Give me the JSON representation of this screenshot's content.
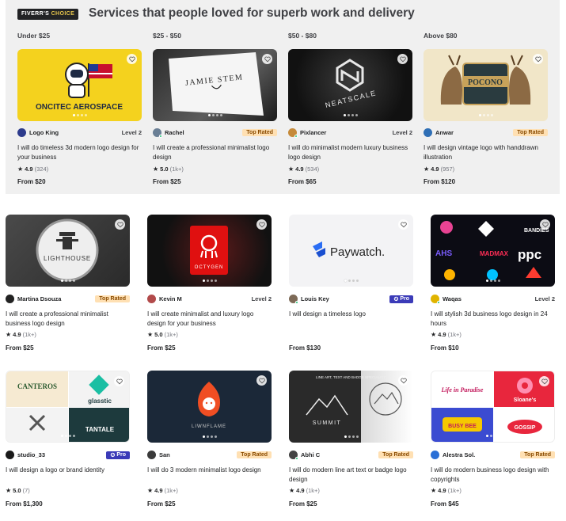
{
  "header": {
    "badge_prefix": "FIVERR'S",
    "badge_suffix": "CHOICE",
    "title": "Services that people loved for superb work and delivery"
  },
  "price_ranges": [
    "Under $25",
    "$25 - $50",
    "$50 - $80",
    "Above $80"
  ],
  "choice_gigs": [
    {
      "seller": "Logo King",
      "level": "Level 2",
      "title": "I will do timeless 3d modern logo design for your business",
      "score": "4.9",
      "count": "(324)",
      "price": "From $20",
      "thumb_text": "ONCITEC AEROSPACE",
      "avatar_color": "#2d3b8c"
    },
    {
      "seller": "Rachel",
      "level": "Top Rated",
      "title": "I will create a professional minimalist logo design",
      "score": "5.0",
      "count": "(1k+)",
      "price": "From $25",
      "thumb_text": "JAMIE STEM",
      "avatar_color": "#6a7f95"
    },
    {
      "seller": "Pixlancer",
      "level": "Level 2",
      "title": "I will do minimalist modern luxury business logo design",
      "score": "4.9",
      "count": "(534)",
      "price": "From $65",
      "thumb_text": "NEATSCALE",
      "avatar_color": "#c58a3a"
    },
    {
      "seller": "Anwar",
      "level": "Top Rated",
      "title": "I will design vintage logo with handdrawn illustration",
      "score": "4.9",
      "count": "(957)",
      "price": "From $120",
      "thumb_text": "POCONO",
      "avatar_color": "#2f6fb5"
    }
  ],
  "gigs": [
    {
      "seller": "Martina Dsouza",
      "level": "Top Rated",
      "title": "I will create a professional minimalist business logo design",
      "score": "4.9",
      "count": "(1k+)",
      "price": "From $25",
      "thumb_text": "LIGHTHOUSE",
      "avatar_color": "#222222"
    },
    {
      "seller": "Kevin M",
      "level": "Level 2",
      "title": "I will create minimalist and luxury logo design for your business",
      "score": "5.0",
      "count": "(1k+)",
      "price": "From $25",
      "thumb_text": "OCTYGEN",
      "avatar_color": "#b24a4a"
    },
    {
      "seller": "Louis Key",
      "level": "Pro",
      "title": "I will design a timeless logo",
      "score": "",
      "count": "",
      "price": "From $130",
      "thumb_text": "Paywatch.",
      "avatar_color": "#7d6a57"
    },
    {
      "seller": "Waqas",
      "level": "Level 2",
      "title": "I will stylish 3d business logo design in 24 hours",
      "score": "4.9",
      "count": "(1k+)",
      "price": "From $10",
      "thumb_text": "ppc",
      "avatar_color": "#e0b400"
    },
    {
      "seller": "studio_33",
      "level": "Pro",
      "title": "I will design a logo or brand identity",
      "score": "5.0",
      "count": "(7)",
      "price": "From $1,300",
      "thumb_text": "CANTEROS",
      "avatar_color": "#1a1a1a"
    },
    {
      "seller": "San",
      "level": "Top Rated",
      "title": "I will do 3 modern minimalist logo design",
      "score": "4.9",
      "count": "(1k+)",
      "price": "From $25",
      "thumb_text": "LIWNFLAME",
      "avatar_color": "#3a3a3a"
    },
    {
      "seller": "Abhi C",
      "level": "Top Rated",
      "title": "I will do modern line art text or badge logo design",
      "score": "4.9",
      "count": "(1k+)",
      "price": "From $25",
      "thumb_text": "SUMMIT",
      "avatar_color": "#444444"
    },
    {
      "seller": "Alestra Sol.",
      "level": "Top Rated",
      "title": "I will do modern business logo design with copyrights",
      "score": "4.9",
      "count": "(1k+)",
      "price": "From $45",
      "thumb_text": "Life in Paradise",
      "avatar_color": "#2a6fd6"
    }
  ],
  "colors": {
    "accent_green": "#1dbf73",
    "top_rated_bg": "#ffe0b3",
    "pro_bg": "#3b3bb8",
    "panel_bg": "#f0f0f0"
  }
}
